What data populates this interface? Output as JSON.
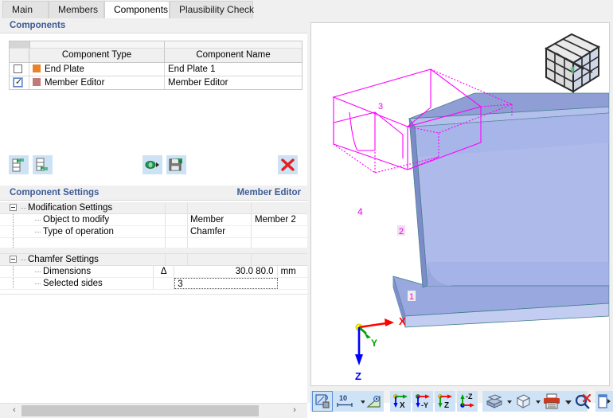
{
  "tabs": [
    {
      "label": "Main",
      "active": false
    },
    {
      "label": "Members",
      "active": false
    },
    {
      "label": "Components",
      "active": true
    },
    {
      "label": "Plausibility Check",
      "active": false
    }
  ],
  "components_panel": {
    "header": "Components",
    "columns": [
      "Component Type",
      "Component Name"
    ],
    "rows": [
      {
        "checked": false,
        "color": "#e8832c",
        "type": "End Plate",
        "name": "End Plate 1"
      },
      {
        "checked": true,
        "color": "#c07a7a",
        "type": "Member Editor",
        "name": "Member Editor"
      }
    ],
    "toolbar": [
      {
        "name": "insert-row-above-button",
        "tip": "Insert Row Above"
      },
      {
        "name": "insert-row-below-button",
        "tip": "Insert Row Below"
      },
      {
        "name": "import-component-button",
        "tip": "Import"
      },
      {
        "name": "save-component-button",
        "tip": "Save"
      },
      {
        "name": "delete-component-button",
        "tip": "Delete"
      }
    ],
    "delete_glyph": "✕"
  },
  "settings_panel": {
    "header": "Component Settings",
    "header_right": "Member Editor",
    "groups": [
      {
        "label": "Modification Settings",
        "rows": [
          {
            "label": "Object to modify",
            "symbol": "",
            "value": "Member",
            "value2": "Member 2"
          },
          {
            "label": "Type of operation",
            "symbol": "",
            "value": "Chamfer",
            "value2": ""
          }
        ]
      },
      {
        "label": "Chamfer Settings",
        "rows": [
          {
            "label": "Dimensions",
            "symbol": "Δ",
            "number": "30.0 80.0",
            "unit": "mm"
          },
          {
            "label": "Selected sides",
            "symbol": "",
            "edit_value": "3"
          }
        ]
      }
    ]
  },
  "scrollbar": {
    "left_arrow": "‹",
    "right_arrow": "›"
  },
  "view3d": {
    "axis_indicator": {
      "x_label": "X",
      "x_color": "#ff0000",
      "y_label": "Y",
      "y_color": "#00a000",
      "z_label": "Z",
      "z_color": "#0000ff",
      "origin_color": "#ffff00"
    },
    "node_labels": [
      "1",
      "2",
      "3",
      "4"
    ],
    "model_color": "#aab6e8",
    "wireframe_color": "#ff00ff",
    "viewcube_name": "view-cube"
  },
  "view_toolbar": {
    "buttons": [
      {
        "name": "render-mode-button",
        "label": "",
        "selected": true
      },
      {
        "name": "scale-button",
        "label": "10"
      },
      {
        "name": "scale-dropdown-arrow",
        "label": "▾"
      },
      {
        "name": "measure-button",
        "label": ""
      },
      {
        "name": "view-x-button",
        "label": "X"
      },
      {
        "name": "view-negy-button",
        "label": "-Y"
      },
      {
        "name": "view-z-button",
        "label": "Z"
      },
      {
        "name": "view-negz-button",
        "label": "-Z"
      },
      {
        "name": "solid-view-button",
        "label": ""
      },
      {
        "name": "solid-dropdown-arrow",
        "label": "▾"
      },
      {
        "name": "wireframe-view-button",
        "label": ""
      },
      {
        "name": "wireframe-dropdown-arrow",
        "label": "▾"
      },
      {
        "name": "print-button",
        "label": ""
      },
      {
        "name": "print-dropdown-arrow",
        "label": "▾"
      },
      {
        "name": "clear-selection-button",
        "label": ""
      },
      {
        "name": "panel-toggle-button",
        "label": ""
      }
    ]
  }
}
